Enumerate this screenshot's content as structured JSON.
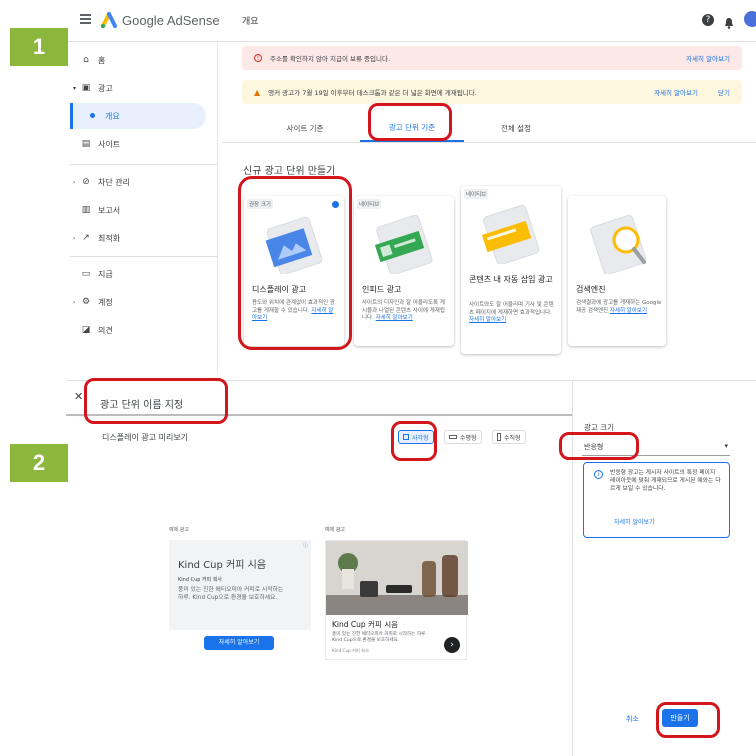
{
  "steps": [
    "1",
    "2"
  ],
  "header": {
    "brand": "Google AdSense",
    "page_title": "개요"
  },
  "sidebar": {
    "items": [
      {
        "label": "홈",
        "icon": "home-icon"
      },
      {
        "label": "광고",
        "icon": "ads-icon"
      },
      {
        "label": "개요",
        "icon": "dot-icon"
      },
      {
        "label": "사이트",
        "icon": "sites-icon"
      },
      {
        "label": "차단 관리",
        "icon": "block-icon"
      },
      {
        "label": "보고서",
        "icon": "report-icon"
      },
      {
        "label": "최적화",
        "icon": "trend-icon"
      },
      {
        "label": "지급",
        "icon": "payment-icon"
      },
      {
        "label": "계정",
        "icon": "gear-icon"
      },
      {
        "label": "의견",
        "icon": "feedback-icon"
      }
    ]
  },
  "alerts": [
    {
      "text": "주소를 확인하지 않아 지급이 보류 중입니다.",
      "actions": [
        "자세히 알아보기"
      ]
    },
    {
      "text": "앵커 광고가 7월 19일 이후부터 데스크톱과 같은 더 넓은 화면에 게재됩니다.",
      "actions": [
        "자세히 알아보기",
        "닫기"
      ]
    }
  ],
  "tabs": [
    "사이트 기준",
    "광고 단위 기준",
    "전체 설정"
  ],
  "create_title": "신규 광고 단위 만들기",
  "cards": [
    {
      "tag": "권장 크기",
      "title": "디스플레이 광고",
      "desc": "용도와 위치에 관계없이 효과적인 광고를 게재할 수 있습니다.",
      "link": "자세히 알아보기"
    },
    {
      "tag": "네이티브",
      "title": "인피드 광고",
      "desc": "사이트의 디자인과 잘 어울리도록 게시물과 나열된 콘텐츠 사이에 게재됩니다.",
      "link": "자세히 알아보기"
    },
    {
      "tag": "네이티브",
      "title": "콘텐츠 내 자동 삽입 광고",
      "desc": "사이트와도 잘 어울리며 기사 및 콘텐츠 페이지에 게재하면 효과적입니다.",
      "link": "자세히 알아보기"
    },
    {
      "tag": "",
      "title": "검색엔진",
      "desc": "검색결과에 광고를 게재하는 Google 제공 검색엔진",
      "link": "자세히 알아보기"
    }
  ],
  "editor": {
    "name_placeholder": "광고 단위 이름 지정",
    "preview_label": "디스플레이 광고 미리보기",
    "formats": [
      "사각형",
      "수평형",
      "수직형"
    ],
    "size_label": "광고 크기",
    "size_value": "반응형",
    "info_text": "반응형 광고는 게시자 사이트의 특정 페이지 레이아웃에 맞춰 게재되므로 게시된 예와는 다르게 보일 수 있습니다.",
    "info_link": "자세히 알아보기",
    "cancel": "취소",
    "create": "만들기"
  },
  "sample_ads": {
    "caption": "예제 광고",
    "text_ad": {
      "title": "Kind Cup 커피 시음",
      "advertiser": "Kind Cup 커피 회사",
      "body": "풍미 있는 진한 에티오피아 커피로 시작하는 하루. Kind Cup으로 환경을 보호하세요.",
      "cta": "자세히 알아보기"
    },
    "image_ad": {
      "title": "Kind Cup 커피 시음",
      "body": "풍미 있는 진한 에티오피아 커피로 시작하는 하루. Kind Cup으로 환경을 보호하세요.",
      "advertiser": "Kind Cup 커피 회사"
    }
  },
  "colors": {
    "accent": "#1a73e8",
    "highlight": "#d3151c",
    "step": "#8cb73f",
    "nav_active": "#e8f0fe"
  }
}
